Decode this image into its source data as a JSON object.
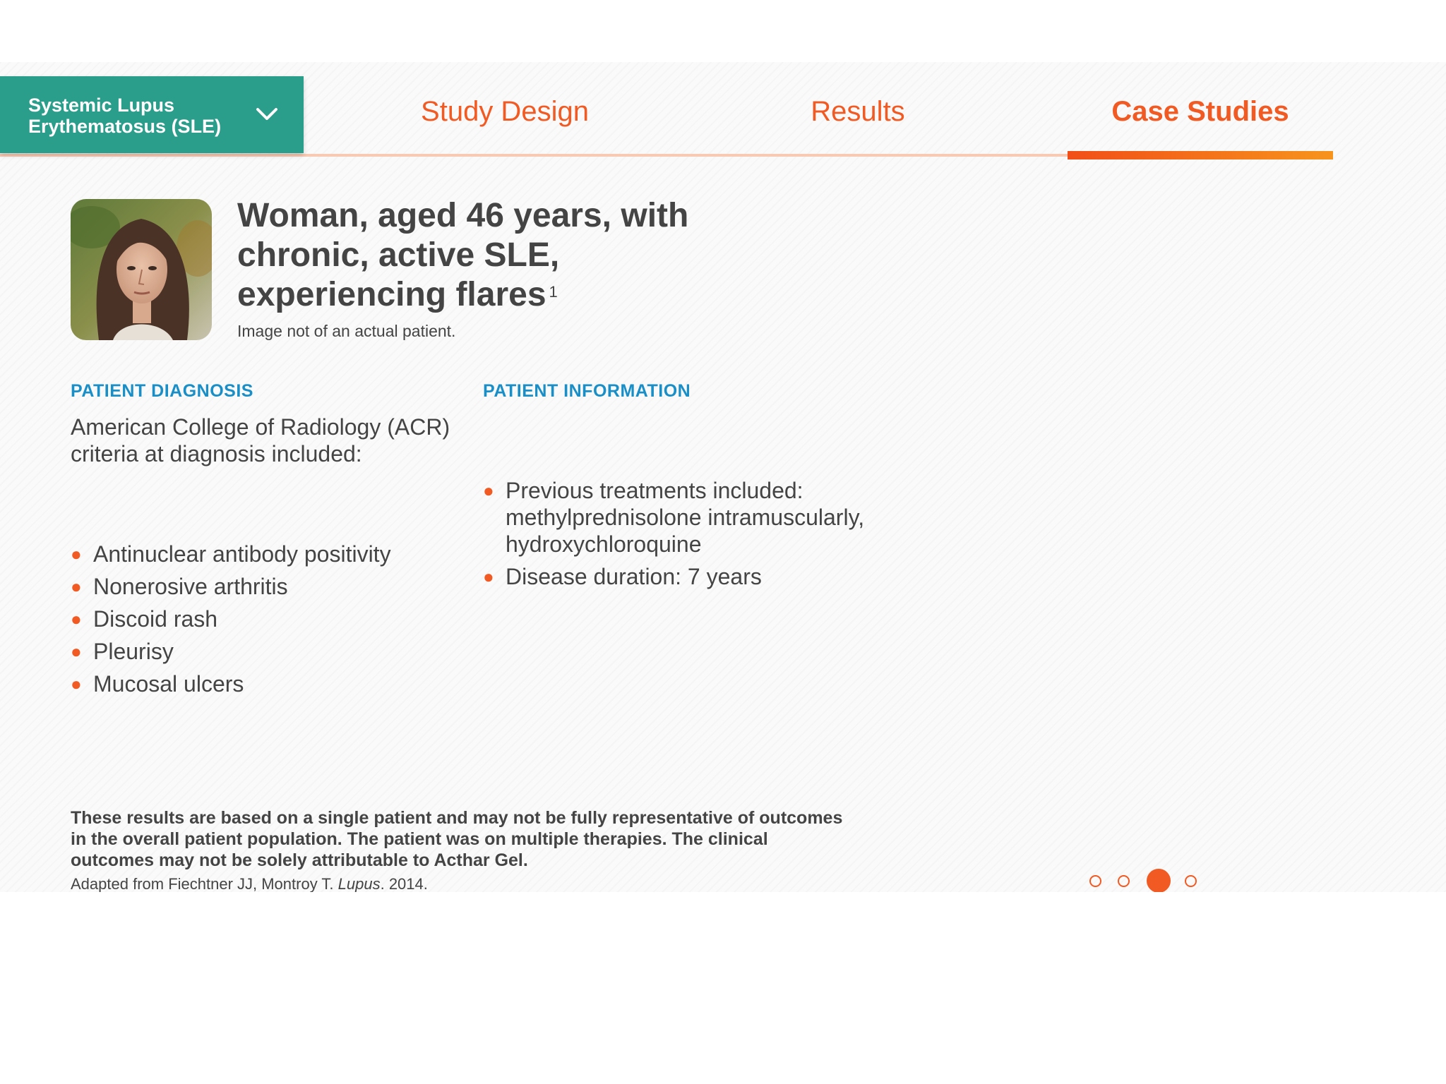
{
  "condition_selector": {
    "label": "Systemic Lupus Erythematosus (SLE)"
  },
  "tabs": [
    {
      "label": "Study Design"
    },
    {
      "label": "Results"
    },
    {
      "label": "Case Studies",
      "active": true
    }
  ],
  "patient": {
    "title": "Woman, aged 46 years, with chronic, active SLE, experiencing flares",
    "title_superscript": "1",
    "photo_note": "Image not of an actual patient."
  },
  "diagnosis": {
    "heading": "PATIENT DIAGNOSIS",
    "intro": "American College of Radiology (ACR) criteria at diagnosis included:",
    "items": [
      "Antinuclear antibody positivity",
      "Nonerosive arthritis",
      "Discoid rash",
      "Pleurisy",
      "Mucosal ulcers"
    ]
  },
  "information": {
    "heading": "PATIENT INFORMATION",
    "items": [
      "Previous treatments included: methylprednisolone intramuscularly, hydroxychloroquine",
      "Disease duration: 7 years"
    ]
  },
  "footer": {
    "disclaimer": "These results are based on a single patient and may not be fully representative of outcomes in the overall patient population. The patient was on multiple therapies. The clinical outcomes may not be solely attributable to Acthar Gel.",
    "citation_prefix": "Adapted from Fiechtner JJ, Montroy T. ",
    "citation_journal": "Lupus",
    "citation_suffix": ". 2014."
  },
  "pager": {
    "total": 4,
    "current": 3
  },
  "colors": {
    "accent_orange": "#f15a22",
    "teal": "#2a9d8b",
    "heading_blue": "#1a8fc7",
    "text_gray": "#444444"
  },
  "icons": {
    "dropdown": "chevron-down-icon",
    "bullet": "bullet-icon"
  }
}
